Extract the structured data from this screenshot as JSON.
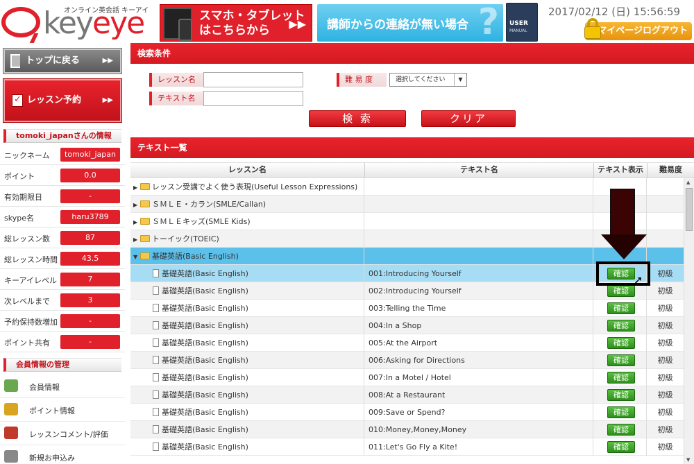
{
  "header": {
    "logo_sub": "オンライン英会話 キーアイ",
    "logo_prefix": "key",
    "logo_accent": "eye",
    "banner_mobile": "スマホ・タブレット\nはこちらから",
    "banner_contact": "講師からの連絡が無い場合",
    "manual_label": "USER",
    "manual_sub": "MANUAL",
    "datetime": "2017/02/12 (日) 15:56:59",
    "logout_label": "マイページログアウト"
  },
  "sidebar": {
    "top_button": "トップに戻る",
    "reserve_button": "レッスン予約",
    "info_title": "tomoki_japanさんの情報",
    "info": [
      {
        "label": "ニックネーム",
        "value": "tomoki_japan"
      },
      {
        "label": "ポイント",
        "value": "0.0"
      },
      {
        "label": "有効期限日",
        "value": "-"
      },
      {
        "label": "skype名",
        "value": "haru3789"
      },
      {
        "label": "総レッスン数",
        "value": "87"
      },
      {
        "label": "総レッスン時間",
        "value": "43.5"
      },
      {
        "label": "キーアイレベル",
        "value": "7"
      },
      {
        "label": "次レベルまで",
        "value": "3"
      },
      {
        "label": "予約保持数増加",
        "value": "-"
      },
      {
        "label": "ポイント共有",
        "value": "-"
      }
    ],
    "member_title": "会員情報の管理",
    "member_items": [
      "会員情報",
      "ポイント情報",
      "レッスンコメント/評価",
      "新規お申込み"
    ]
  },
  "search": {
    "title": "検索条件",
    "lesson_label": "レッスン名",
    "text_label": "テキスト名",
    "difficulty_label": "難 易 度",
    "difficulty_select": "選択してください",
    "search_button": "検 索",
    "clear_button": "クリア"
  },
  "list": {
    "title": "テキスト一覧",
    "columns": [
      "レッスン名",
      "テキスト名",
      "テキスト表示",
      "難易度"
    ],
    "folders": [
      "レッスン受講でよく使う表現(Useful Lesson Expressions)",
      "ＳＭＬＥ・カラン(SMLE/Callan)",
      "ＳＭＬＥキッズ(SMLE Kids)",
      "トーイック(TOEIC)",
      "基礎英語(Basic English)"
    ],
    "lesson": "基礎英語(Basic English)",
    "button_label": "確認",
    "level": "初級",
    "texts": [
      "001:Introducing Yourself",
      "002:Introducing Yourself",
      "003:Telling the Time",
      "004:In a Shop",
      "005:At the Airport",
      "006:Asking for Directions",
      "007:In a Motel / Hotel",
      "008:At a Restaurant",
      "009:Save or Spend?",
      "010:Money,Money,Money",
      "011:Let's Go Fly a Kite!"
    ]
  },
  "colors": {
    "accent": "#e0202a",
    "selected_folder": "#5bc0ea",
    "selected_row": "#a6dcf4",
    "button_green": "#3aa527"
  }
}
